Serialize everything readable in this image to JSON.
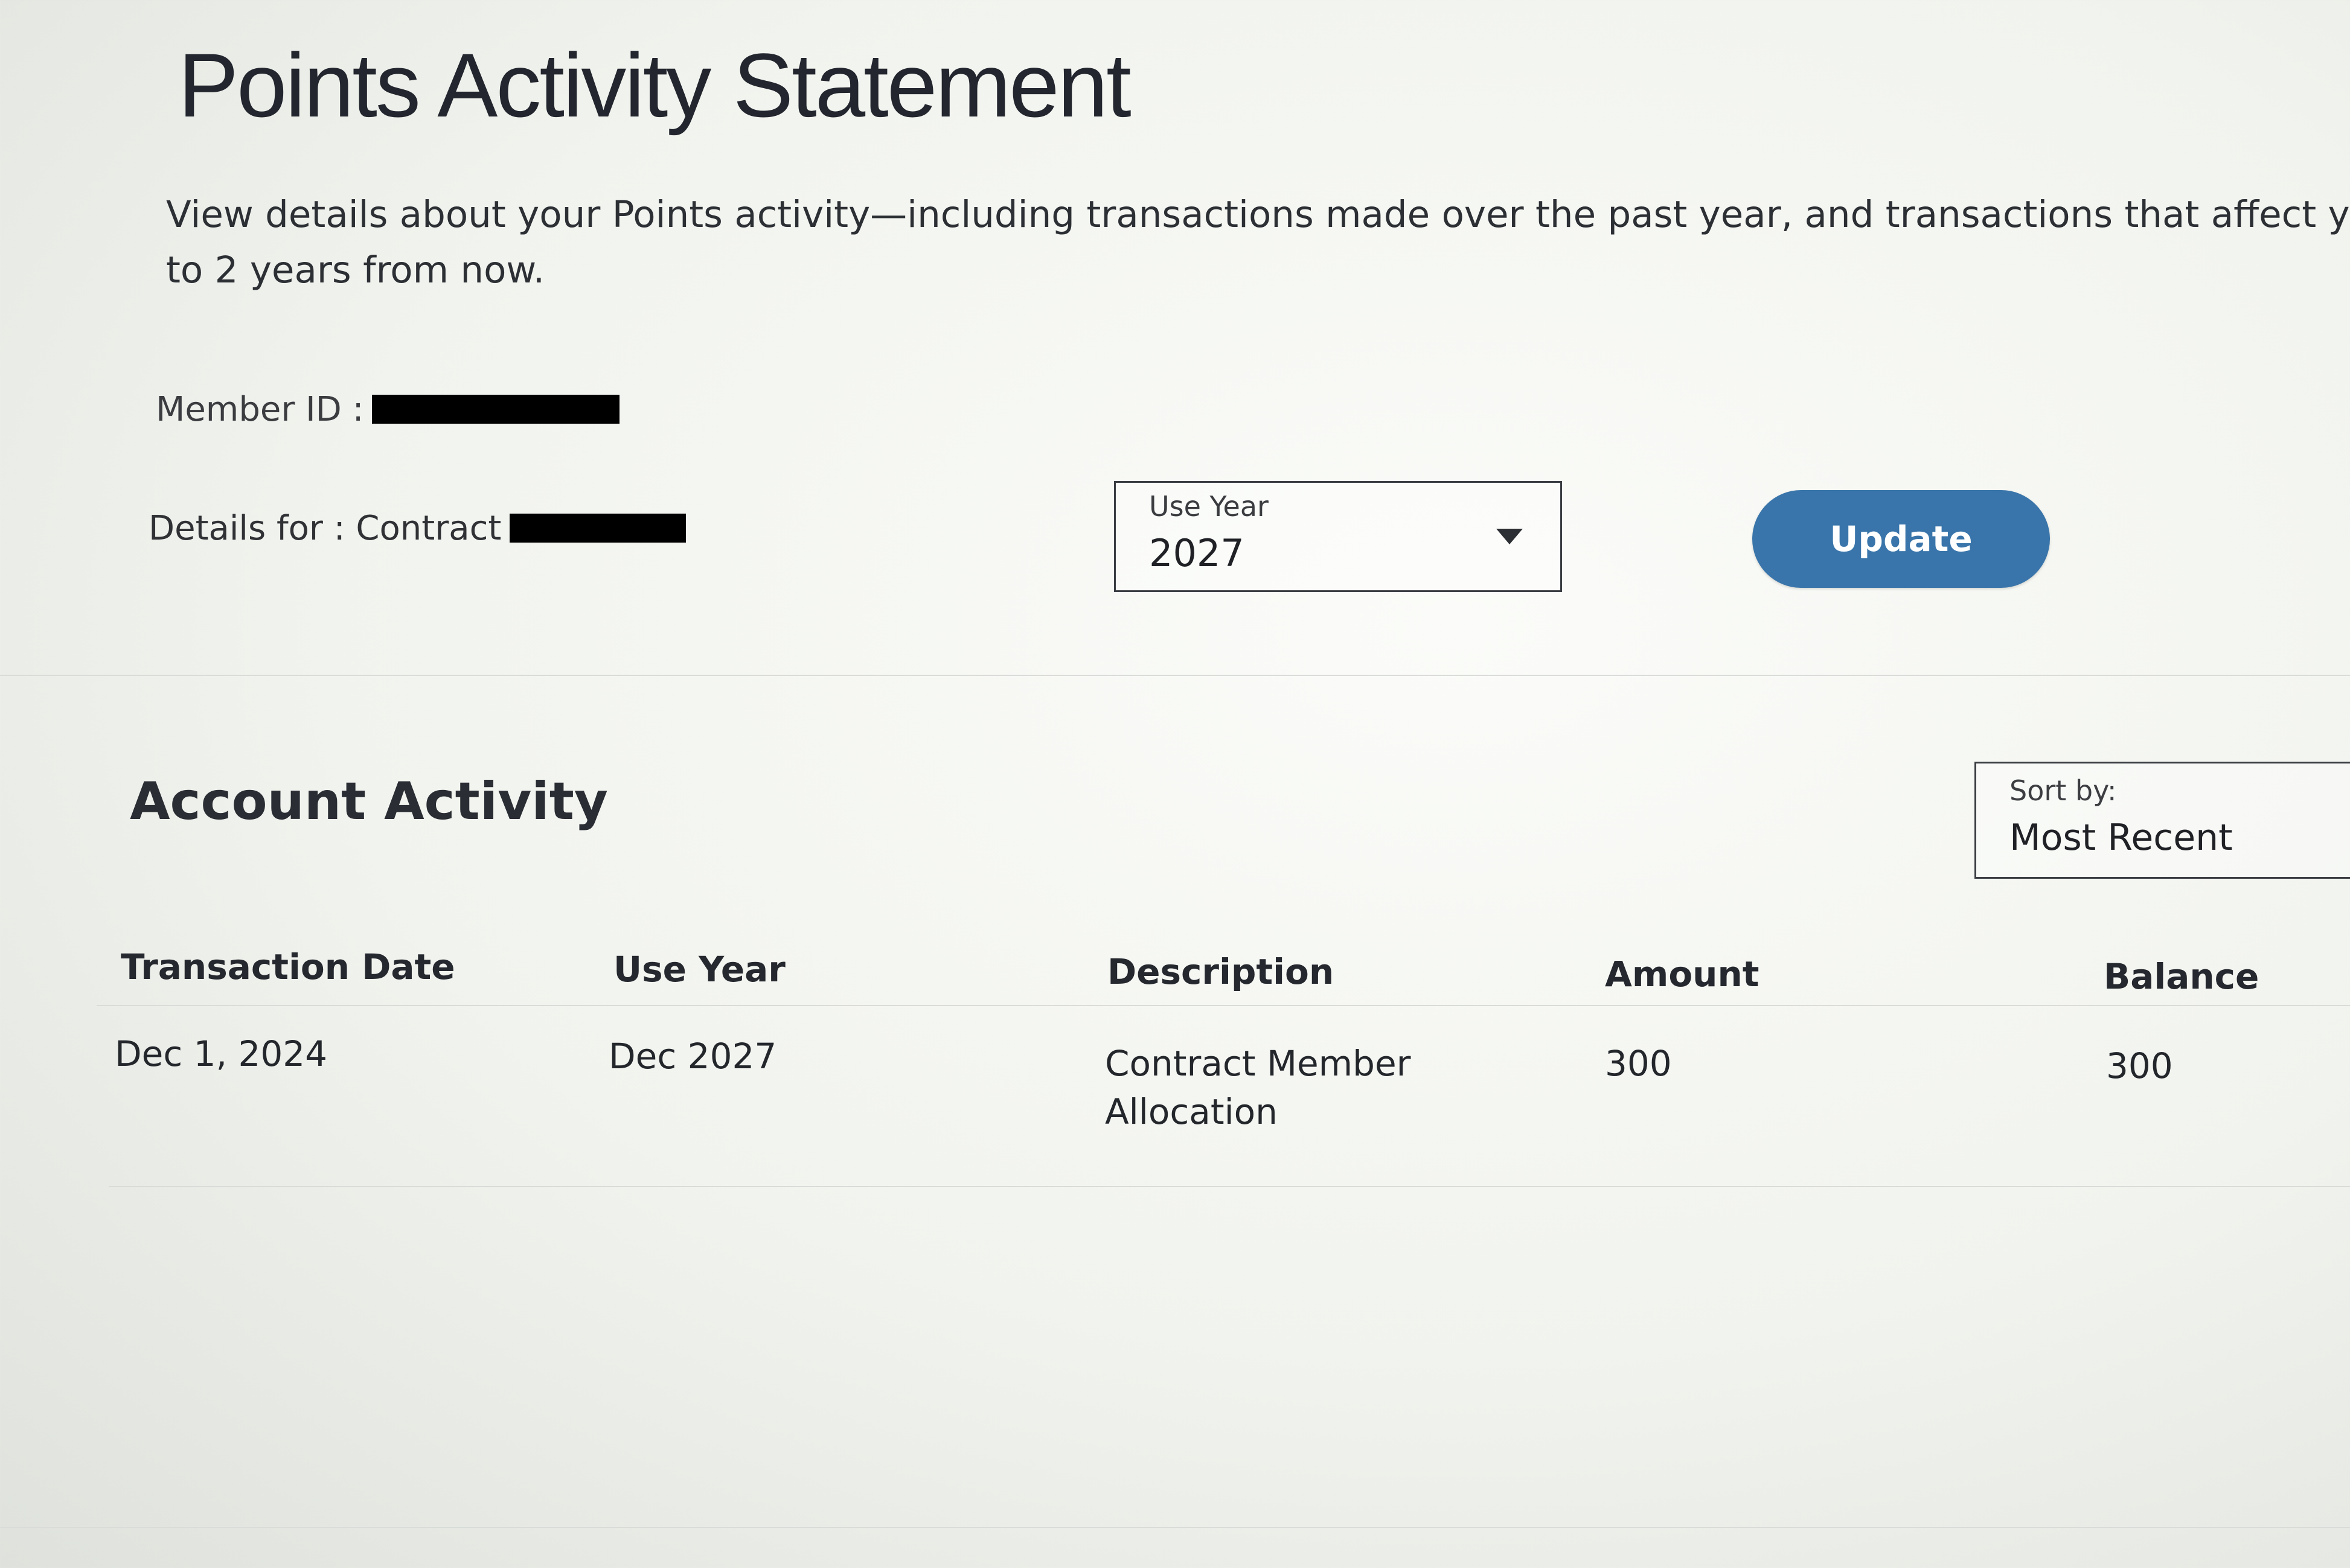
{
  "header": {
    "title": "Points Activity Statement",
    "intro_line1": "View details about your Points activity—including transactions made over the past year, and transactions that affect your Mem",
    "intro_line2": "to 2 years from now."
  },
  "member": {
    "member_id_label": "Member ID :",
    "details_label": "Details for : Contract"
  },
  "use_year_select": {
    "label": "Use Year",
    "value": "2027"
  },
  "update_button": {
    "label": "Update"
  },
  "account_activity": {
    "title": "Account Activity",
    "sort": {
      "label": "Sort by:",
      "value": "Most Recent"
    },
    "columns": [
      "Transaction Date",
      "Use Year",
      "Description",
      "Amount",
      "Balance"
    ],
    "rows": [
      {
        "transaction_date": "Dec 1, 2024",
        "use_year": "Dec 2027",
        "description": "Contract Member Allocation",
        "amount": "300",
        "balance": "300"
      }
    ]
  },
  "colors": {
    "accent": "#3975aa"
  }
}
